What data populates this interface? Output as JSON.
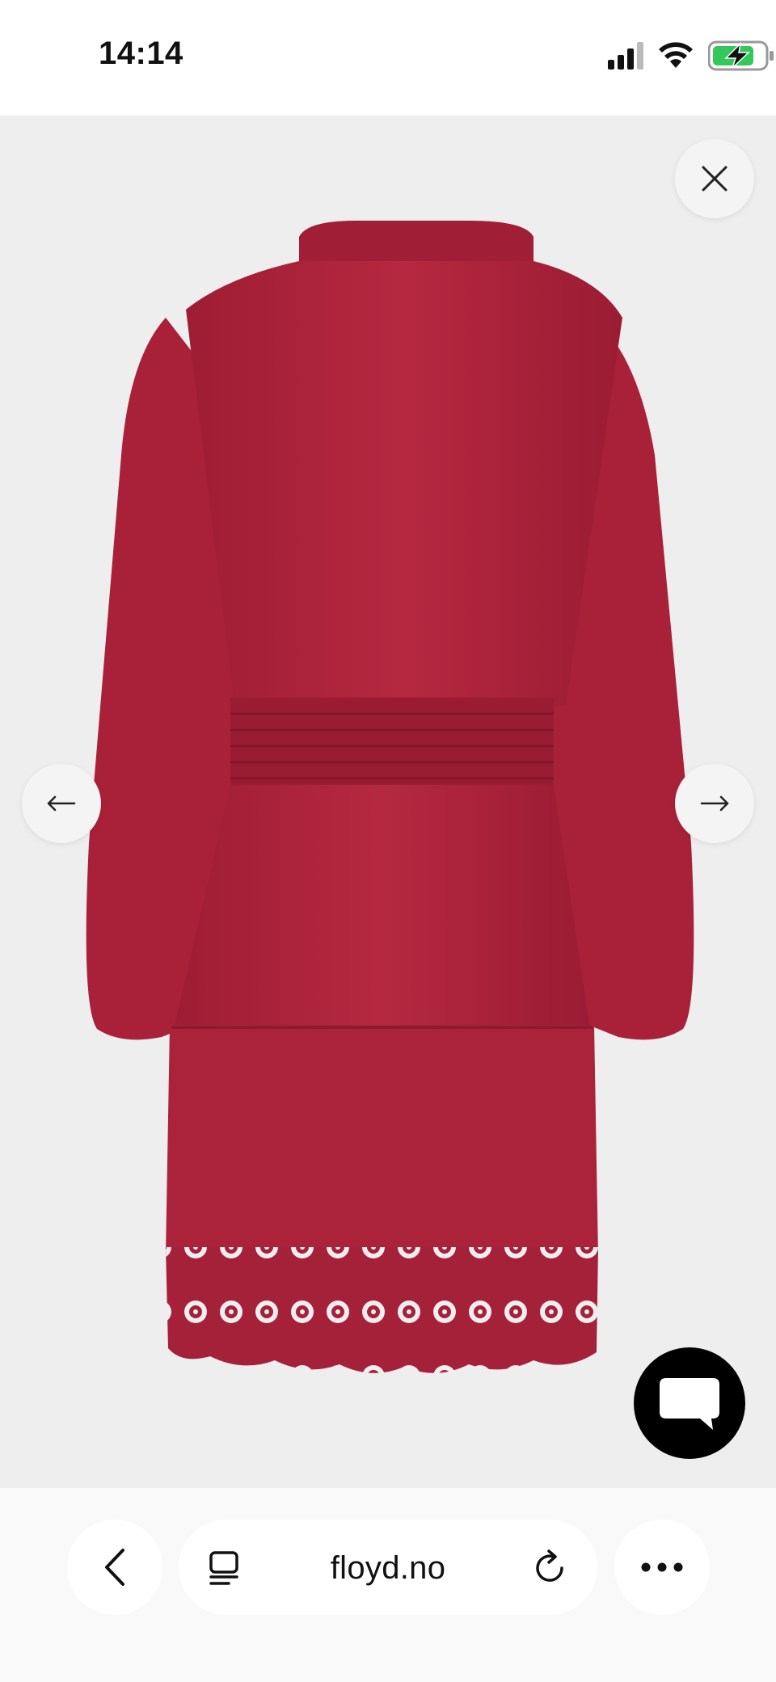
{
  "status_bar": {
    "time": "14:14",
    "signal_icon": "cellular-signal-icon",
    "wifi_icon": "wifi-icon",
    "battery_icon": "battery-charging-icon",
    "battery_color": "#34c759"
  },
  "viewer": {
    "image_background": "#efeeef",
    "dress_color": "#b0243c",
    "close_icon": "close-icon",
    "prev_icon": "arrow-left-icon",
    "next_icon": "arrow-right-icon",
    "chat_icon": "chat-bubble-icon"
  },
  "browser_bar": {
    "back_icon": "chevron-left-icon",
    "tabs_icon": "tabs-icon",
    "url": "floyd.no",
    "reload_icon": "reload-icon",
    "more_icon": "more-icon"
  }
}
